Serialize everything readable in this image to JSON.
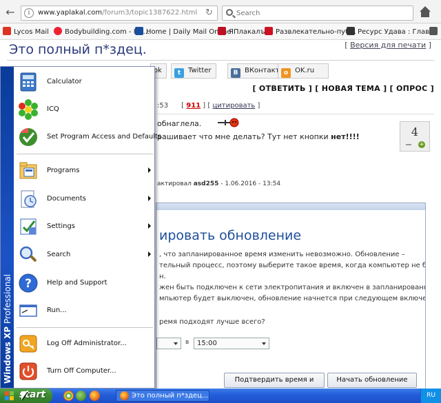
{
  "browser": {
    "url_host": "www.yaplakal.com",
    "url_path": "/forum3/topic1387622.html",
    "search_placeholder": "Search",
    "bookmarks": [
      {
        "label": "Lycos Mail",
        "color": "#d32"
      },
      {
        "label": "Bodybuilding.com - Hu...",
        "color": "#e23"
      },
      {
        "label": "Home | Daily Mail Online",
        "color": "#1a4fa0"
      },
      {
        "label": "ЯПлакалъ",
        "color": "#b12"
      },
      {
        "label": "Развлекательно-пуб...",
        "color": "#c12"
      },
      {
        "label": "Ресурс Удава : Глав...",
        "color": "#333"
      }
    ]
  },
  "page": {
    "title": "Это полный п*здец.",
    "print_link": "Версия для печати",
    "share": [
      {
        "label": "Twitter",
        "icon": "twitter-icon",
        "color": "#3aa0e0"
      },
      {
        "label": "ВКонтакте",
        "icon": "vk-icon",
        "color": "#4a6f9c"
      },
      {
        "label": "OK.ru",
        "icon": "ok-icon",
        "color": "#f19322"
      }
    ],
    "share_partial": "ok",
    "actions": "[ ОТВЕТИТЬ ] [ НОВАЯ ТЕМА ] [ ОПРОС ]",
    "post_time": ":53",
    "post_number": "911",
    "cite": "цитировать",
    "line1": "обнаглела.",
    "line2_pre": "рашивает что мне делать? Тут нет кнопки ",
    "line2_bold": "нет!!!!",
    "rating": "4",
    "edited_prefix": "актировал ",
    "edited_user": "asd255",
    "edited_suffix": " - 1.06.2016 - 13:54",
    "embed": {
      "heading": "ировать обновление",
      "lines": [
        ", что запланированное время изменить невозможно. Обновление –",
        "тельный процесс, поэтому выберите такое время, когда компьютер не будет",
        "н.",
        "жен быть подключен к сети электропитания и включен в запланированное",
        "мпьютер будет выключен, обновление начнется при следующем включении"
      ],
      "question": "ремя подходят лучше всего?",
      "between": "в",
      "time_value": "15:00",
      "confirm_button": "Подтвердить время и закрыть",
      "start_button": "Начать обновление"
    }
  },
  "startmenu": {
    "band_bold": "Windows XP",
    "band_rest": " Professional",
    "items": [
      {
        "label": "Calculator"
      },
      {
        "label": "ICQ"
      },
      {
        "label": "Set Program Access and Defaults"
      },
      {
        "label": "Programs"
      },
      {
        "label": "Documents"
      },
      {
        "label": "Settings"
      },
      {
        "label": "Search"
      },
      {
        "label": "Help and Support"
      },
      {
        "label": "Run..."
      },
      {
        "label": "Log Off Administrator..."
      },
      {
        "label": "Turn Off Computer..."
      }
    ]
  },
  "taskbar": {
    "start_label": "start",
    "task_label": "Это полный п*здец....",
    "tray_text": "RU"
  }
}
